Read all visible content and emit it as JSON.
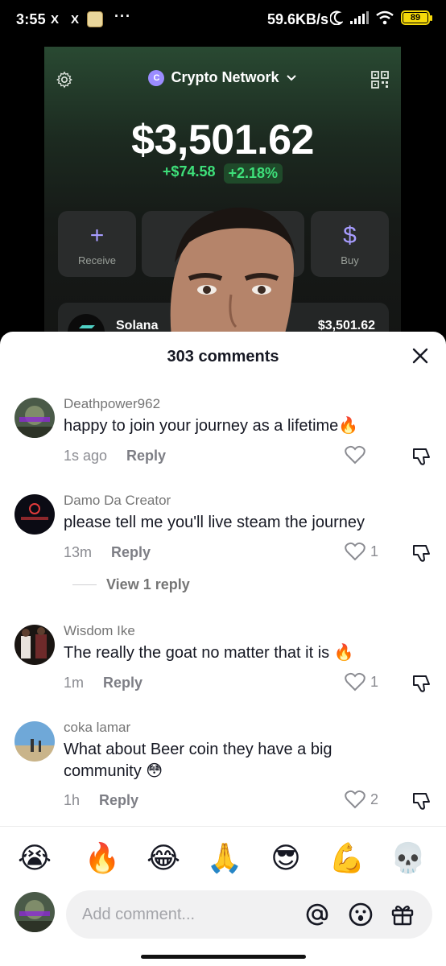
{
  "status_bar": {
    "time": "3:55",
    "notif_x1": "X",
    "notif_x2": "X",
    "more": "···",
    "net_speed": "59.6KB/s",
    "battery": "89"
  },
  "video": {
    "network_badge": "C",
    "network_name": "Crypto Network",
    "balance": "$3,501.62",
    "change_amount": "+$74.58",
    "change_percent": "+2.18%",
    "actions": [
      {
        "label": "Receive",
        "icon": "plus-icon",
        "glyph": "+"
      },
      {
        "label": "",
        "icon": "hidden",
        "glyph": ""
      },
      {
        "label": "",
        "icon": "hidden",
        "glyph": ""
      },
      {
        "label": "Buy",
        "icon": "dollar-icon",
        "glyph": "$"
      }
    ],
    "asset_name": "Solana",
    "asset_value": "$3,501.62",
    "accent": "#9b8cff",
    "positive": "#3ee07a"
  },
  "sheet": {
    "title": "303 comments",
    "comments": [
      {
        "user": "Deathpower962",
        "text": "happy to join your journey as a lifetime🔥",
        "time": "1s ago",
        "reply": "Reply",
        "likes": ""
      },
      {
        "user": "Damo Da Creator",
        "text": "please tell me you'll live steam the journey",
        "time": "13m",
        "reply": "Reply",
        "likes": "1"
      },
      {
        "user": "Wisdom Ike",
        "text": "The really the goat no matter that it is 🔥",
        "time": "1m",
        "reply": "Reply",
        "likes": "1"
      },
      {
        "user": "coka lamar",
        "text": "What about Beer coin they have a big community 😳",
        "time": "1h",
        "reply": "Reply",
        "likes": "2"
      }
    ],
    "view_replies": "View 1 reply",
    "avatar_text_damo": "Damo Da Creator",
    "emojis": [
      "😭",
      "🔥",
      "😂",
      "🙏",
      "😎",
      "💪",
      "💀"
    ],
    "input_placeholder": "Add comment..."
  }
}
